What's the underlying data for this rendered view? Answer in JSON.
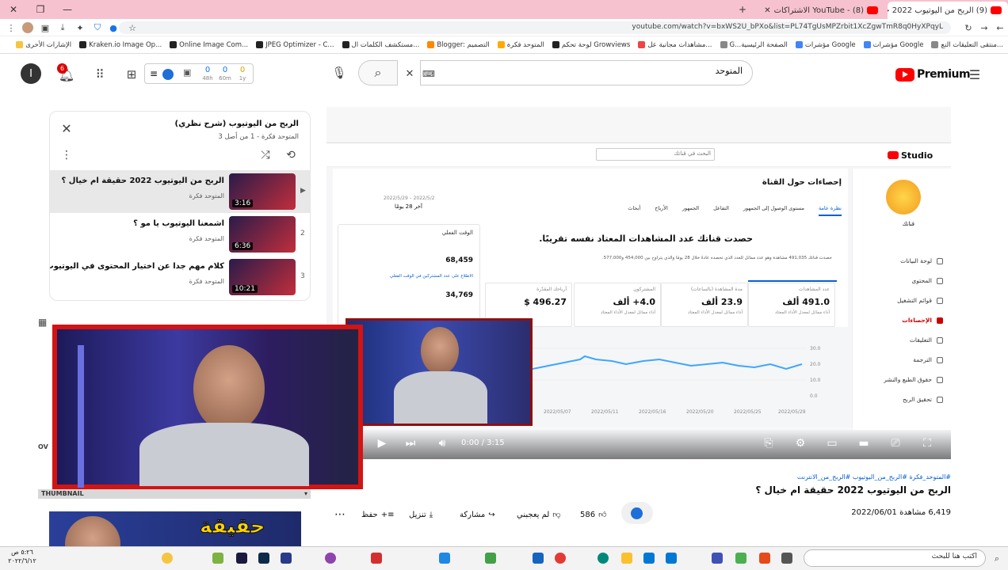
{
  "browser": {
    "tabs": [
      {
        "label": "(9) الربح من اليوتيوب 2022 حقيقة",
        "active": true
      },
      {
        "label": "YouTube - (8) الاشتراكات",
        "active": false
      }
    ],
    "url": "youtube.com/watch?v=bxWS2U_bPXo&list=PL74TgUsMPZrbit1XcZgwTmR8q0HyXPqyL",
    "bookmarks": [
      "منتقى التعليقات النع...",
      "مؤشرات Google",
      "مؤشرات Google",
      "G...الصفحة الرئيسية",
      "مشاهدات مجانية عل...",
      "لوحة تحكم Growviews",
      "المتوحد فكرة",
      "Blogger: التصميم",
      "مستكشف الكلمات ال...",
      "JPEG Optimizer - C...",
      "Online Image Com...",
      "Kraken.io Image Op...",
      "الإشارات الأخرى"
    ]
  },
  "youtube": {
    "search_value": "المتوحد",
    "notif_count": "6",
    "avatar_letter": "I",
    "logo_text": "Premium",
    "ext_counters": [
      {
        "value": "0",
        "unit": "48h"
      },
      {
        "value": "0",
        "unit": "60m"
      },
      {
        "value": "0",
        "unit": "1y"
      }
    ]
  },
  "playlist": {
    "title": "الربح من اليوتيوب (شرح نظري)",
    "subtitle": "المتوحد فكرة - 1 من أصل 3",
    "items": [
      {
        "index": "▶",
        "title": "الربح من اليوتيوب 2022 حقيقة ام خيال ؟",
        "channel": "المتوحد فكرة",
        "duration": "3:16"
      },
      {
        "index": "2",
        "title": "اشمعنا اليوتيوب يا مو ؟",
        "channel": "المتوحد فكرة",
        "duration": "6:36"
      },
      {
        "index": "3",
        "title": "كلام مهم جدا عن اختيار المحتوى في اليوتيوب",
        "channel": "المتوحد فكرة",
        "duration": "10:21"
      }
    ]
  },
  "studio": {
    "page_title": "إحصاءات حول القناة",
    "period": "آخر 28 يومًا",
    "period_range": "2022/5/2 – 2022/5/29",
    "tabs": [
      "نظرة عامة",
      "مستوى الوصول إلى الجمهور",
      "التفاعل",
      "الجمهور",
      "الأرباح",
      "أبحاث"
    ],
    "headline": "حصدت قناتك عدد المشاهدات المعتاد نفسه تقريبًا.",
    "subline": "حصدت قناتك 491,035 مشاهدة وهو عدد مماثل للعدد الذي تحصده عادةً خلال 28 يومًا والذي يتراوح بين 454,000 و577,000.",
    "metrics": [
      {
        "label": "عدد المشاهدات",
        "value": "491.0 ألف",
        "sub": "أداء مماثل لمعدل الأداء المعتاد"
      },
      {
        "label": "مدة المشاهدة (بالساعات)",
        "value": "23.9 ألف",
        "sub": "أداء مماثل لمعدل الأداء المعتاد"
      },
      {
        "label": "المشتركون",
        "value": "4.0+ ألف",
        "sub": "أداء مماثل لمعدل الأداء المعتاد"
      },
      {
        "label": "أرباحك المقدّرة",
        "value": "496.27 $",
        "sub": ""
      }
    ],
    "realtime": {
      "label": "الوقت الفعلي",
      "value1": "68,459",
      "value2": "34,769",
      "link": "الاطلاع على عدد المشتركين في الوقت الفعلي"
    },
    "side_items": [
      "لوحة البيانات",
      "المحتوى",
      "قوائم التشغيل",
      "الإحصاءات",
      "التعليقات",
      "الترجمة",
      "حقوق الطبع والنشر",
      "تحقيق الربح"
    ],
    "channel_label": "قناتك",
    "search_placeholder": "البحث في قناتك",
    "x_dates": [
      "2022/05/07",
      "2022/05/11",
      "2022/05/16",
      "2022/05/20",
      "2022/05/25",
      "2022/05/29"
    ],
    "y_ticks": [
      "30.0",
      "20.0",
      "10.0",
      "0.0"
    ]
  },
  "player": {
    "time": "0:00 / 3:15"
  },
  "video": {
    "hashtags": "#المتوحد_فكرة #الربح_من_اليوتيوب #الربح_من_الانترنت",
    "title": "الربح من اليوتيوب 2022 حقيقة ام خيال ؟",
    "views_date": "6,419 مشاهدة  2022/06/01",
    "likes": "586",
    "dislike_label": "لم يعجبني",
    "share_label": "مشاركة",
    "download_label": "تنزيل",
    "save_label": "حفظ"
  },
  "sidebar": {
    "section_label": "THUMBNAIL",
    "thumb_text": "حقيقة"
  },
  "taskbar": {
    "search_placeholder": "اكتب هنا للبحث",
    "clock_time": "٥:٢٦ ص",
    "clock_date": "٢٠٢٢/٦/١٢"
  }
}
